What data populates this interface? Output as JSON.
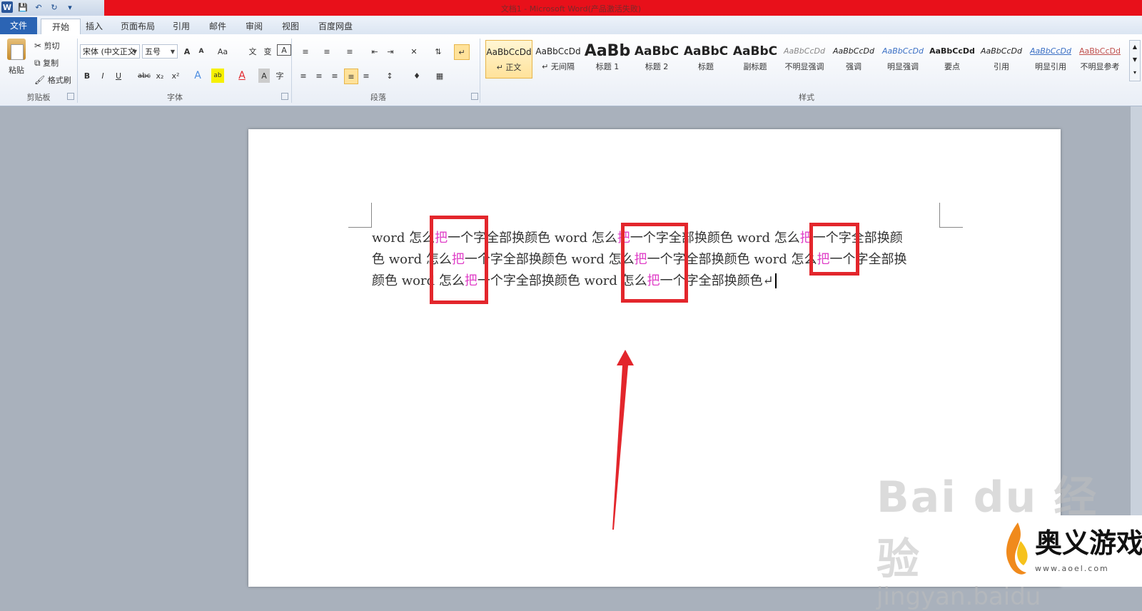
{
  "window": {
    "title": "文档1 - Microsoft Word(产品激活失败)"
  },
  "qat": {
    "icons": [
      "word-logo",
      "save-icon",
      "undo-icon",
      "redo-icon",
      "customize-icon"
    ]
  },
  "tabs": [
    "文件",
    "开始",
    "插入",
    "页面布局",
    "引用",
    "邮件",
    "审阅",
    "视图",
    "百度网盘"
  ],
  "clipboard": {
    "paste": "粘贴",
    "cut": "剪切",
    "copy": "复制",
    "format_painter": "格式刷",
    "label": "剪贴板"
  },
  "font": {
    "name": "宋体 (中文正文",
    "size": "五号",
    "label": "字体",
    "grow": "A",
    "shrink": "A",
    "change_case": "Aa",
    "bold": "B",
    "italic": "I",
    "underline": "U",
    "strike": "abc",
    "subscript": "x₂",
    "superscript": "x²"
  },
  "paragraph": {
    "label": "段落"
  },
  "styles": {
    "label": "样式",
    "items": [
      {
        "sample": "AaBbCcDd",
        "name": "↵ 正文"
      },
      {
        "sample": "AaBbCcDd",
        "name": "↵ 无间隔"
      },
      {
        "sample": "AaBb",
        "name": "标题 1"
      },
      {
        "sample": "AaBbC",
        "name": "标题 2"
      },
      {
        "sample": "AaBbC",
        "name": "标题"
      },
      {
        "sample": "AaBbC",
        "name": "副标题"
      },
      {
        "sample": "AaBbCcDd",
        "name": "不明显强调"
      },
      {
        "sample": "AaBbCcDd",
        "name": "强调"
      },
      {
        "sample": "AaBbCcDd",
        "name": "明显强调"
      },
      {
        "sample": "AaBbCcDd",
        "name": "要点"
      },
      {
        "sample": "AaBbCcDd",
        "name": "引用"
      },
      {
        "sample": "AaBbCcDd",
        "name": "明显引用"
      },
      {
        "sample": "AaBbCcDd",
        "name": "不明显参考"
      }
    ]
  },
  "document": {
    "line1": [
      " word 怎么",
      "把",
      "一个字全部换颜色 word 怎么",
      "把",
      "一个字全部换颜色 word 怎么",
      "把",
      "一个字全部换颜"
    ],
    "line2": [
      "色 word 怎么",
      "把",
      "一个字全部换颜色 word 怎么",
      "把",
      "一个字全部换颜色 word 怎么",
      "把",
      "一个字全部换"
    ],
    "line3": [
      "颜色 word 怎么",
      "把",
      "一个字全部换颜色 word 怎么",
      "把",
      "一个字全部换颜色↵"
    ]
  },
  "watermark": {
    "brand": "Bai  du 经验",
    "url": "jingyan.baidu"
  },
  "badge": {
    "text": "奥义游戏网",
    "url": "www.aoel.com"
  },
  "colors": {
    "highlight": "#e040c8",
    "annotation": "#e3262c",
    "title_bar": "#e8101a",
    "file_tab": "#2b64b4"
  }
}
